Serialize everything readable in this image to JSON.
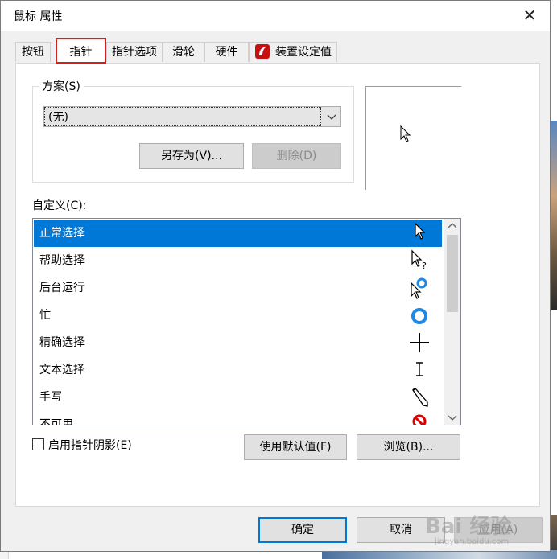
{
  "window": {
    "title": "鼠标 属性",
    "close_glyph": "✕"
  },
  "tabs": [
    {
      "label": "按钮",
      "active": false
    },
    {
      "label": "指针",
      "active": true
    },
    {
      "label": "指针选项",
      "active": false
    },
    {
      "label": "滑轮",
      "active": false
    },
    {
      "label": "硬件",
      "active": false
    },
    {
      "label": "装置设定值",
      "active": false,
      "icon": "device-settings-icon"
    }
  ],
  "scheme": {
    "group_label": "方案(S)",
    "selected": "(无)",
    "save_as_label": "另存为(V)...",
    "delete_label": "删除(D)"
  },
  "custom": {
    "label": "自定义(C):",
    "items": [
      {
        "label": "正常选择",
        "icon": "arrow-cursor-icon",
        "selected": true
      },
      {
        "label": "帮助选择",
        "icon": "help-cursor-icon",
        "selected": false
      },
      {
        "label": "后台运行",
        "icon": "working-in-background-cursor-icon",
        "selected": false
      },
      {
        "label": "忙",
        "icon": "busy-cursor-icon",
        "selected": false
      },
      {
        "label": "精确选择",
        "icon": "crosshair-cursor-icon",
        "selected": false
      },
      {
        "label": "文本选择",
        "icon": "text-beam-cursor-icon",
        "selected": false
      },
      {
        "label": "手写",
        "icon": "pen-cursor-icon",
        "selected": false
      },
      {
        "label": "不可用",
        "icon": "unavailable-cursor-icon",
        "selected": false
      }
    ]
  },
  "shadow_checkbox": {
    "label": "启用指针阴影(E)",
    "checked": false
  },
  "buttons": {
    "use_default": "使用默认值(F)",
    "browse": "浏览(B)...",
    "ok": "确定",
    "cancel": "取消",
    "apply": "应用(A)"
  },
  "watermark": {
    "text": "Bai 经验",
    "sub": "jingyan.baidu.com"
  },
  "colors": {
    "accent": "#0078d7",
    "tab_highlight": "#d02020"
  }
}
